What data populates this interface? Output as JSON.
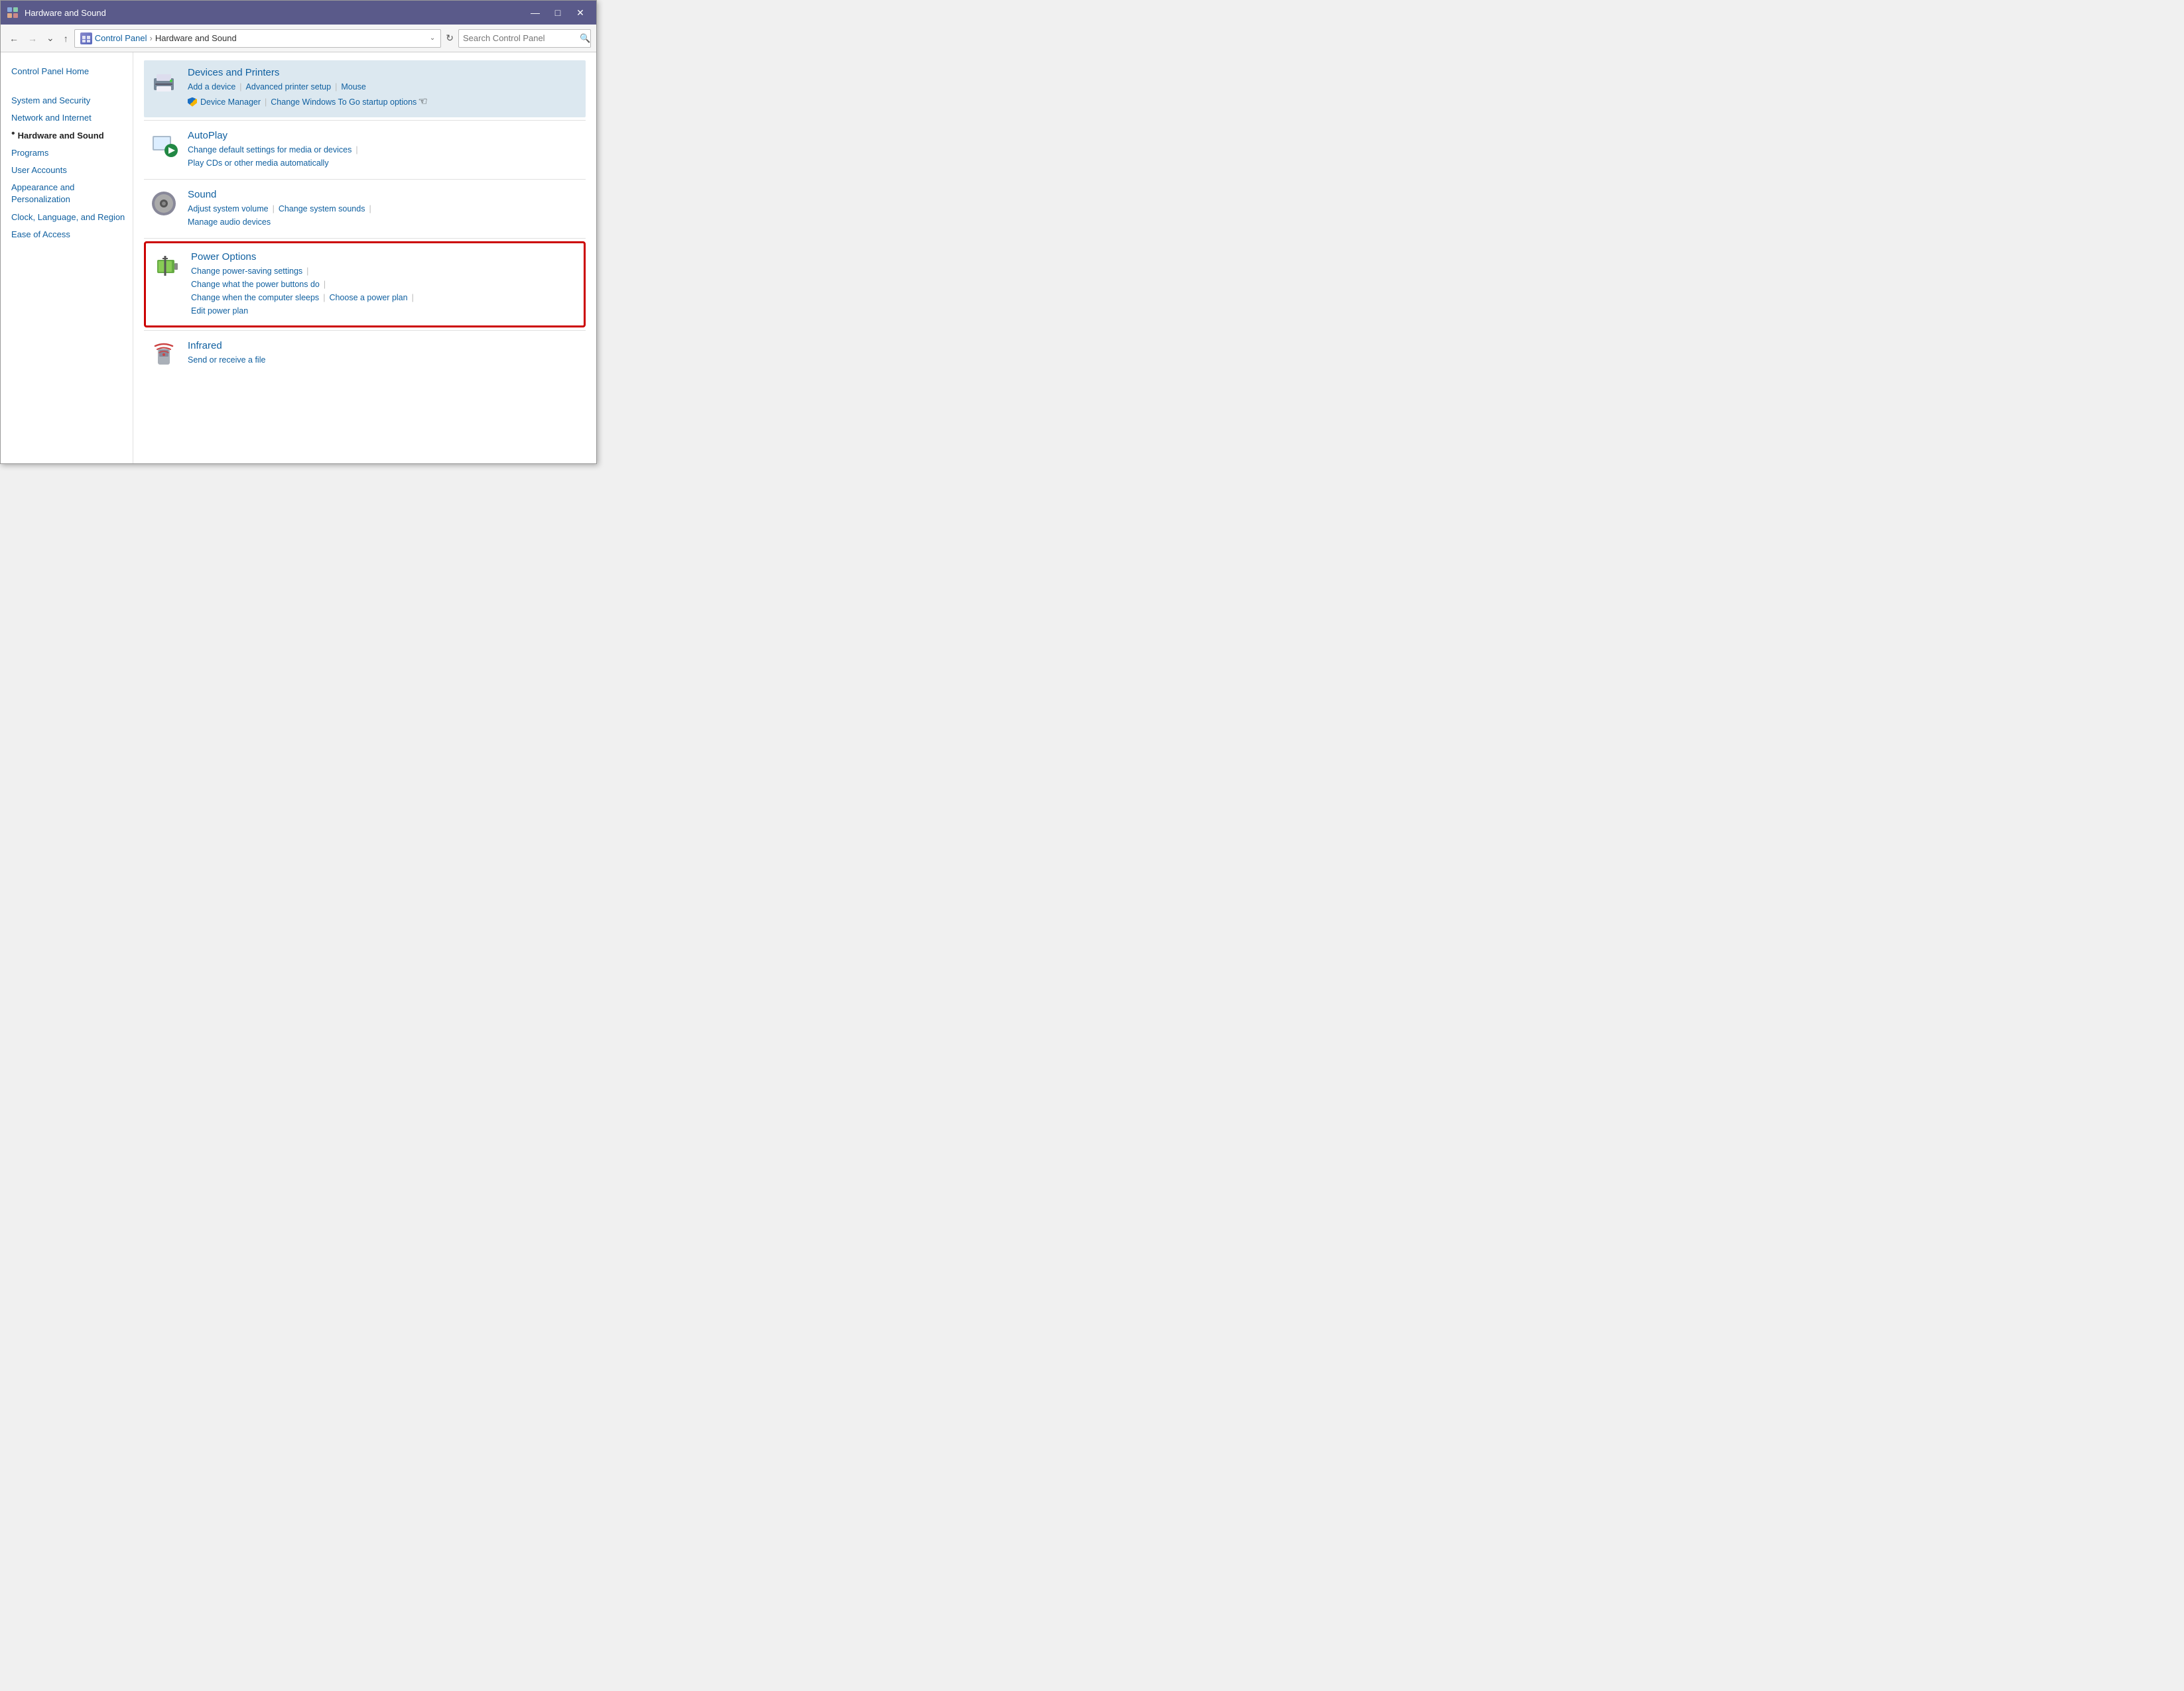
{
  "window": {
    "title": "Hardware and Sound",
    "minimize_label": "—",
    "restore_label": "□",
    "close_label": "✕"
  },
  "addressbar": {
    "back_title": "Back",
    "forward_title": "Forward",
    "up_title": "Up",
    "breadcrumb_root": "Control Panel",
    "breadcrumb_current": "Hardware and Sound",
    "refresh_title": "Refresh",
    "search_placeholder": "Search Control Panel",
    "search_title": "Search"
  },
  "sidebar": {
    "items": [
      {
        "label": "Control Panel Home",
        "active": false
      },
      {
        "label": "System and Security",
        "active": false
      },
      {
        "label": "Network and Internet",
        "active": false
      },
      {
        "label": "Hardware and Sound",
        "active": true
      },
      {
        "label": "Programs",
        "active": false
      },
      {
        "label": "User Accounts",
        "active": false
      },
      {
        "label": "Appearance and Personalization",
        "active": false
      },
      {
        "label": "Clock, Language, and Region",
        "active": false
      },
      {
        "label": "Ease of Access",
        "active": false
      }
    ]
  },
  "sections": [
    {
      "id": "devices-printers",
      "title": "Devices and Printers",
      "links": [
        {
          "label": "Add a device",
          "shield": false
        },
        {
          "label": "Advanced printer setup",
          "shield": false
        },
        {
          "label": "Mouse",
          "shield": false
        },
        {
          "label": "Device Manager",
          "shield": true
        },
        {
          "label": "Change Windows To Go startup options",
          "shield": false
        }
      ],
      "highlighted": true,
      "border": false
    },
    {
      "id": "autoplay",
      "title": "AutoPlay",
      "links": [
        {
          "label": "Change default settings for media or devices",
          "shield": false
        },
        {
          "label": "Play CDs or other media automatically",
          "shield": false
        }
      ],
      "highlighted": false,
      "border": false
    },
    {
      "id": "sound",
      "title": "Sound",
      "links": [
        {
          "label": "Adjust system volume",
          "shield": false
        },
        {
          "label": "Change system sounds",
          "shield": false
        },
        {
          "label": "Manage audio devices",
          "shield": false
        }
      ],
      "highlighted": false,
      "border": false
    },
    {
      "id": "power-options",
      "title": "Power Options",
      "links": [
        {
          "label": "Change power-saving settings",
          "shield": false
        },
        {
          "label": "Change what the power buttons do",
          "shield": false
        },
        {
          "label": "Change when the computer sleeps",
          "shield": false
        },
        {
          "label": "Choose a power plan",
          "shield": false
        },
        {
          "label": "Edit power plan",
          "shield": false
        }
      ],
      "highlighted": false,
      "border": true
    },
    {
      "id": "infrared",
      "title": "Infrared",
      "links": [
        {
          "label": "Send or receive a file",
          "shield": false
        }
      ],
      "highlighted": false,
      "border": false
    }
  ]
}
